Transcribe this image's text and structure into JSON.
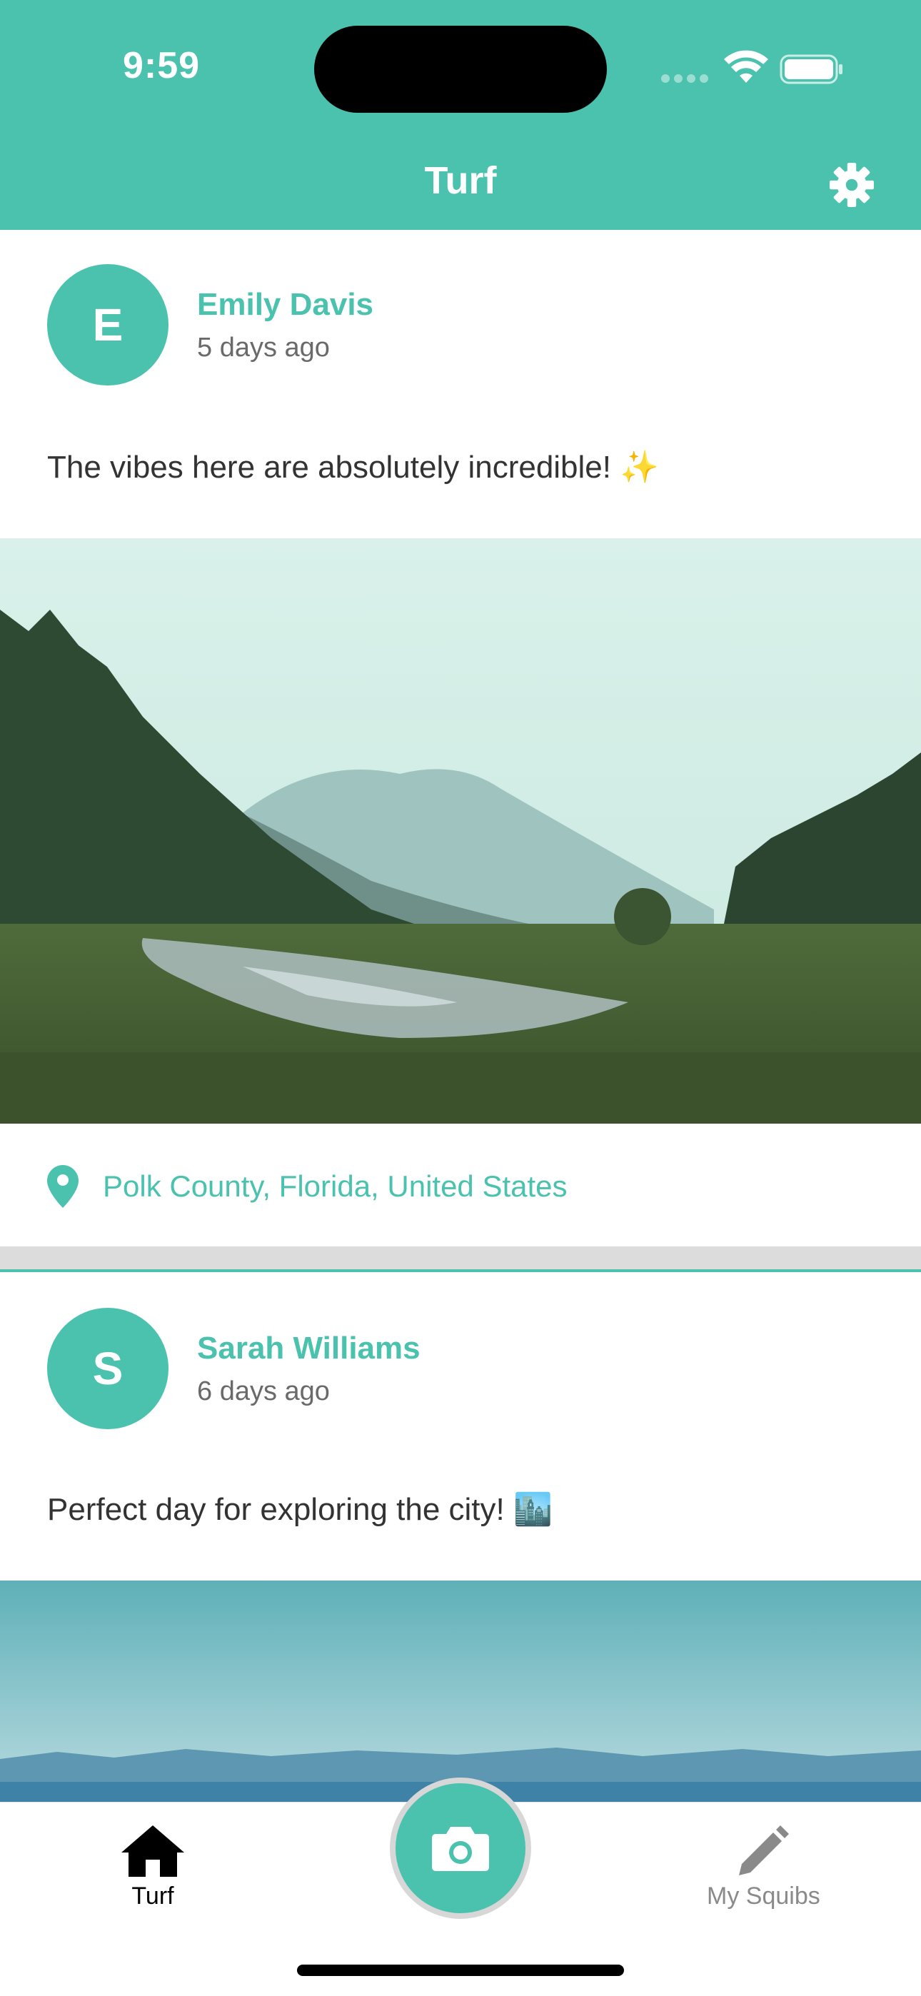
{
  "status_bar": {
    "time": "9:59"
  },
  "header": {
    "title": "Turf",
    "settings_icon": "gear-icon"
  },
  "posts": [
    {
      "avatar_initial": "E",
      "author": "Emily Davis",
      "time_ago": "5 days ago",
      "text": "The vibes here are absolutely incredible! ✨",
      "location": "Polk County, Florida, United States",
      "image": "misty forest river valley landscape"
    },
    {
      "avatar_initial": "S",
      "author": "Sarah Williams",
      "time_ago": "6 days ago",
      "text": "Perfect day for exploring the city! 🏙️",
      "image": "blue sky over distant mountains and water"
    }
  ],
  "tab_bar": {
    "tabs": [
      {
        "label": "Turf",
        "icon": "home-icon",
        "active": true
      },
      {
        "label": "My Squibs",
        "icon": "pencil-icon",
        "active": false
      }
    ],
    "center_icon": "camera-icon"
  },
  "colors": {
    "accent": "#4ac2ae",
    "muted": "#6a6a6a",
    "active_tab": "#000000",
    "inactive_tab": "#8a8a8a"
  }
}
